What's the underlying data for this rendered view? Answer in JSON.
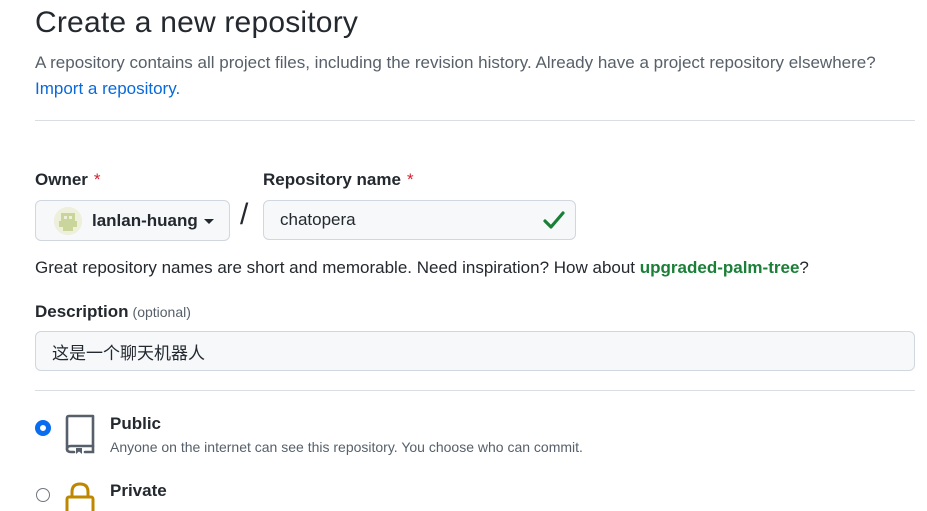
{
  "header": {
    "title": "Create a new repository",
    "subtitle": "A repository contains all project files, including the revision history. Already have a project repository elsewhere?",
    "import_link": "Import a repository."
  },
  "owner": {
    "label": "Owner",
    "required_mark": "*",
    "selected": "lanlan-huang",
    "icons": [
      "avatar",
      "chevron-down-icon"
    ]
  },
  "separator": "/",
  "repo_name": {
    "label": "Repository name",
    "required_mark": "*",
    "value": "chatopera",
    "valid_icon": "check-icon"
  },
  "name_hint": {
    "text": "Great repository names are short and memorable. Need inspiration? How about ",
    "suggestion": "upgraded-palm-tree",
    "suffix": "?"
  },
  "description": {
    "label": "Description",
    "optional": "(optional)",
    "value": "这是一个聊天机器人"
  },
  "visibility": {
    "options": [
      {
        "title": "Public",
        "description": "Anyone on the internet can see this repository. You choose who can commit.",
        "icon": "repo-book-icon",
        "selected": true
      },
      {
        "title": "Private",
        "description": "",
        "icon": "lock-icon",
        "selected": false
      }
    ]
  },
  "colors": {
    "link": "#0969da",
    "success": "#1a7f37",
    "required": "#cf222e",
    "radio_selected": "#0a6df0"
  }
}
